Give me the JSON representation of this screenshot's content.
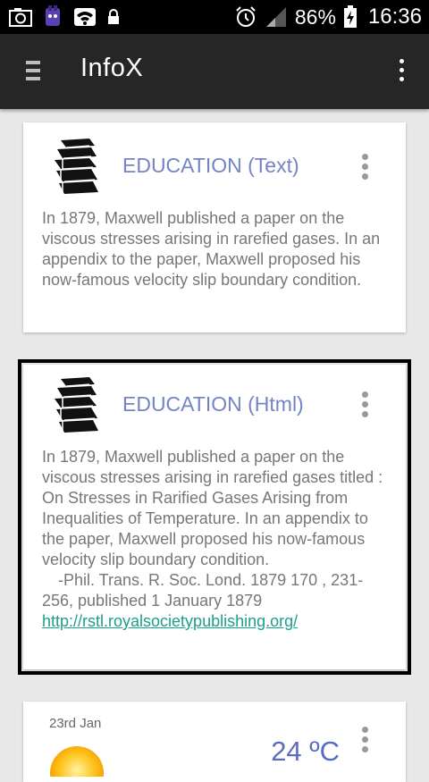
{
  "status_bar": {
    "battery": "86%",
    "time": "16:36",
    "icons": [
      "camera-icon",
      "app-icon",
      "wifi-icon",
      "lock-icon",
      "alarm-icon",
      "signal-icon",
      "battery-charging-icon"
    ]
  },
  "app_bar": {
    "title": "InfoX",
    "menu_icon": "hamburger-icon",
    "overflow_icon": "vertical-dots-icon",
    "background": "#262626"
  },
  "cards": [
    {
      "title": "EDUCATION (Text)",
      "icon": "books-icon",
      "body": "In 1879, Maxwell published a paper on the viscous stresses arising in rarefied gases. In an appendix to the paper, Maxwell proposed his now-famous velocity slip boundary condition."
    },
    {
      "title": "EDUCATION (Html)",
      "icon": "books-icon",
      "body": "In 1879, Maxwell published a paper on the viscous stresses arising in rarefied gases titled : On Stresses in Rarified Gases Arising from Inequalities of Temperature. In an appendix to the paper, Maxwell proposed his now-famous velocity slip boundary condition.",
      "source": "-Phil. Trans. R. Soc. Lond. 1879 170 , 231-256, published 1 January 1879",
      "link": "http://rstl.royalsocietypublishing.org/"
    },
    {
      "date": "23rd Jan",
      "icon": "sun-icon",
      "temperature": "24 ºC"
    }
  ],
  "colors": {
    "title_accent": "#7484c4",
    "link": "#1ca089",
    "background": "#e8e8e8"
  }
}
